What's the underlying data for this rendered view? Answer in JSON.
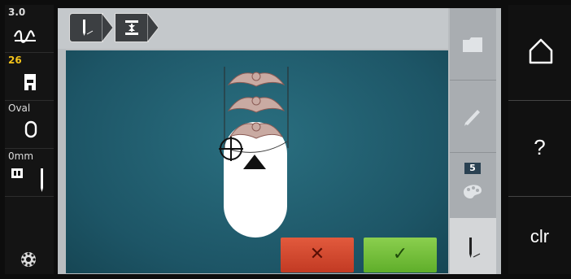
{
  "left_bar": {
    "stitch_length": "3.0",
    "presser_foot": "26",
    "hoop": "Oval",
    "needle_position": "0mm"
  },
  "side_panel": {
    "badge": "5"
  },
  "right_nav": {
    "help_label": "?",
    "clear_label": "clr"
  },
  "actions": {
    "cancel_symbol": "✕",
    "confirm_symbol": "✓"
  },
  "colors": {
    "canvas": "#1f5a6b",
    "cancel": "#d14a30",
    "confirm": "#73bf39",
    "accent_yellow": "#f2c21b"
  }
}
